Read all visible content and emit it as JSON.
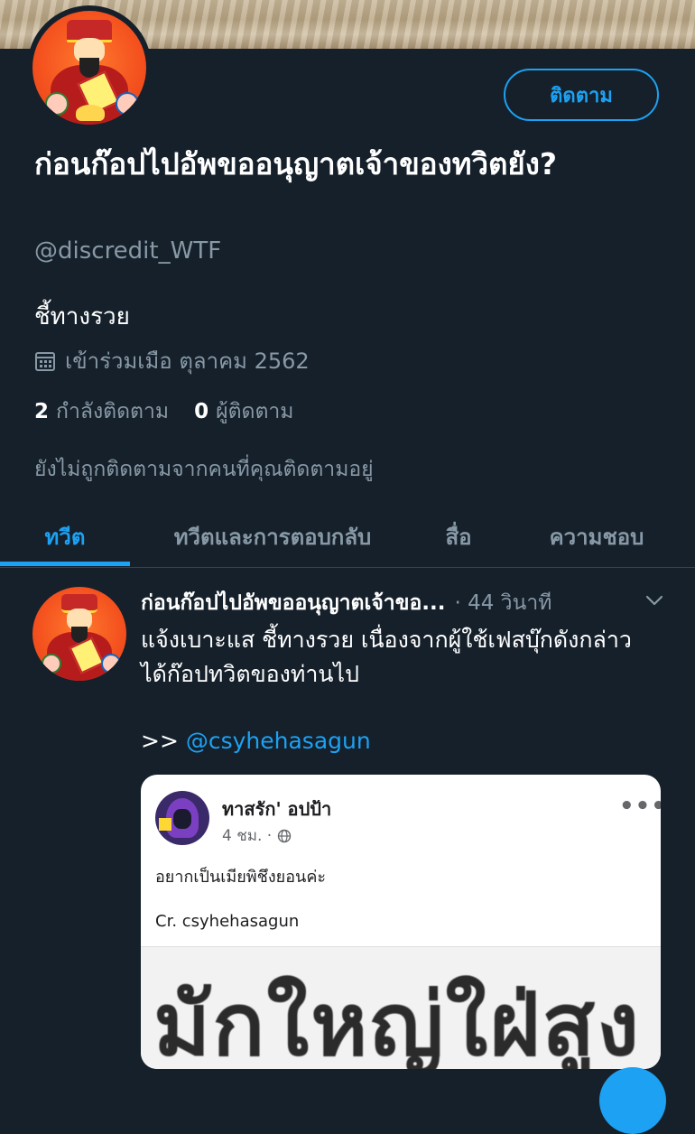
{
  "profile": {
    "display_name": "ก่อนก๊อปไปอัพขออนุญาตเจ้าของทวิตยัง?",
    "handle": "@discredit_WTF",
    "bio": "ชี้ทางรวย",
    "joined": "เข้าร่วมเมือ ตุลาคม 2562",
    "following_count": "2",
    "following_label": "กำลังติดตาม",
    "followers_count": "0",
    "followers_label": "ผู้ติดตาม",
    "not_followed_note": "ยังไม่ถูกติดตามจากคนที่คุณติดตามอยู่",
    "follow_button": "ติดตาม"
  },
  "tabs": [
    {
      "label": "ทวีต",
      "active": true
    },
    {
      "label": "ทวีตและการตอบกลับ",
      "active": false
    },
    {
      "label": "สื่อ",
      "active": false
    },
    {
      "label": "ความชอบ",
      "active": false
    }
  ],
  "tweet": {
    "author": "ก่อนก๊อปไปอัพขออนุญาตเจ้าขอ",
    "ellipsis": "...",
    "time": "· 44 วินาที",
    "text": "แจ้งเบาะแส ชี้ทางรวย เนื่องจากผู้ใช้เฟสบุ๊กดังกล่าว ได้ก๊อปทวิตของท่านไป",
    "link_prefix": ">> ",
    "mention": "@csyhehasagun",
    "card": {
      "name": "ทาสรัก' อปป้า",
      "meta": "4 ชม. ·",
      "more": "•••",
      "text": "อยากเป็นเมียพิชึงยอนค่ะ",
      "credit": "Cr. csyhehasagun",
      "image_text": "มักใหญ่ใฝ่สูง"
    }
  },
  "colors": {
    "background": "#15202b",
    "accent": "#1da1f2",
    "muted": "#8899a6"
  }
}
